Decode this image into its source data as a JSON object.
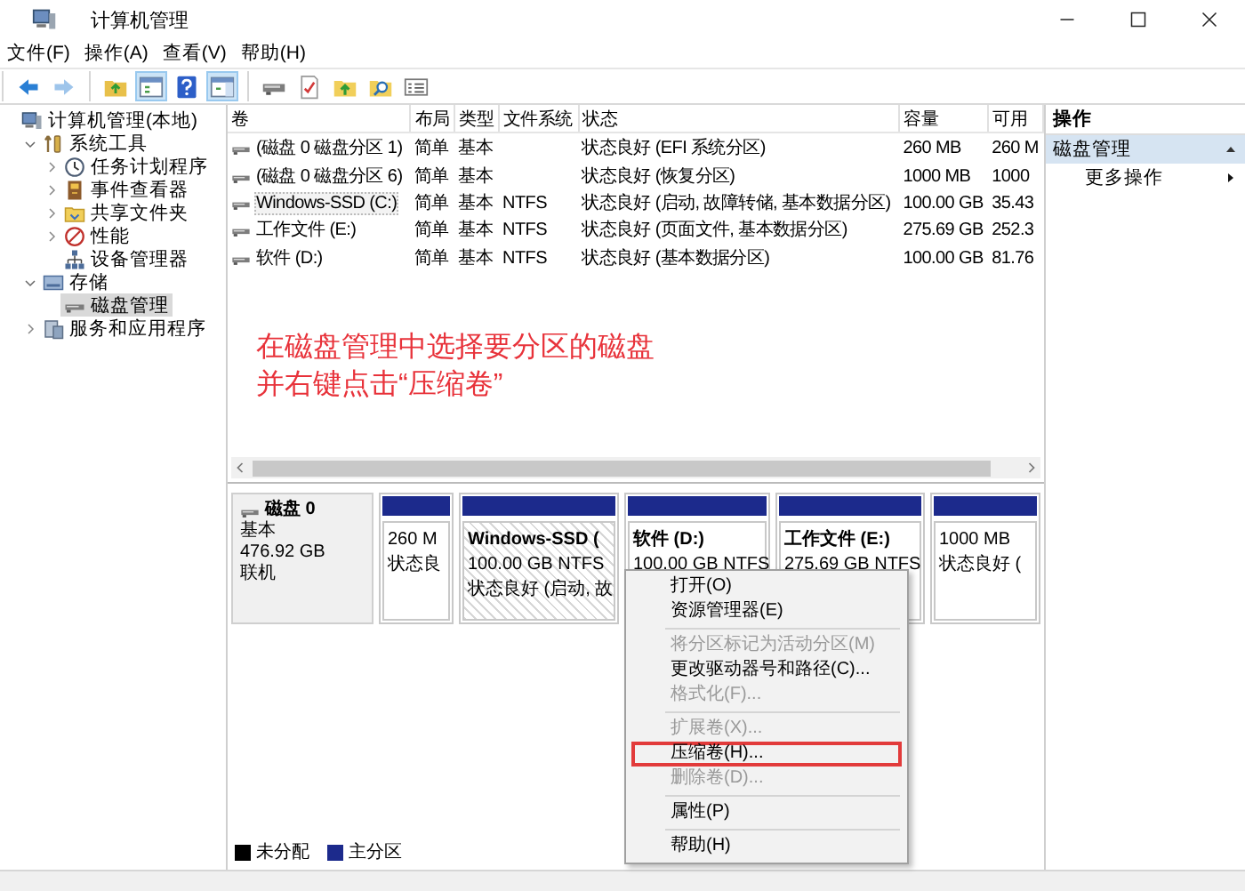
{
  "window": {
    "title": "计算机管理"
  },
  "menu": [
    "文件(F)",
    "操作(A)",
    "查看(V)",
    "帮助(H)"
  ],
  "toolbar": [
    [
      {
        "kind": "back",
        "pressed": false,
        "disabled": false
      },
      {
        "kind": "forward",
        "pressed": false,
        "disabled": true
      }
    ],
    [
      {
        "kind": "upfolder",
        "pressed": false,
        "disabled": false
      },
      {
        "kind": "tree",
        "pressed": true,
        "disabled": false
      },
      {
        "kind": "help",
        "pressed": false,
        "disabled": false
      },
      {
        "kind": "pane",
        "pressed": true,
        "disabled": false
      }
    ],
    [
      {
        "kind": "drive",
        "pressed": false,
        "disabled": false
      },
      {
        "kind": "check",
        "pressed": false,
        "disabled": false
      },
      {
        "kind": "folderarrow",
        "pressed": false,
        "disabled": false
      },
      {
        "kind": "foldersearch",
        "pressed": false,
        "disabled": false
      },
      {
        "kind": "list",
        "pressed": false,
        "disabled": false
      }
    ]
  ],
  "tree": [
    {
      "label": "计算机管理(本地)",
      "kind": "computer",
      "selected": false,
      "children": [
        {
          "label": "系统工具",
          "kind": "tools",
          "expanded": true,
          "selected": false,
          "children": [
            {
              "label": "任务计划程序",
              "kind": "clock",
              "expanded": false,
              "selected": false
            },
            {
              "label": "事件查看器",
              "kind": "log",
              "expanded": false,
              "selected": false
            },
            {
              "label": "共享文件夹",
              "kind": "share",
              "expanded": false,
              "selected": false
            },
            {
              "label": "性能",
              "kind": "perf",
              "expanded": false,
              "selected": false
            },
            {
              "label": "设备管理器",
              "kind": "device",
              "selected": false
            }
          ]
        },
        {
          "label": "存储",
          "kind": "storage",
          "expanded": true,
          "selected": false,
          "children": [
            {
              "label": "磁盘管理",
              "kind": "disk",
              "selected": true
            }
          ]
        },
        {
          "label": "服务和应用程序",
          "kind": "services",
          "expanded": false,
          "selected": false
        }
      ]
    }
  ],
  "table": {
    "columns": [
      "卷",
      "布局",
      "类型",
      "文件系统",
      "状态",
      "容量",
      "可用"
    ],
    "rows": [
      {
        "volume": "(磁盘 0 磁盘分区 1)",
        "layout": "简单",
        "type": "基本",
        "status": "状态良好 (EFI 系统分区)",
        "capacity": "260 MB",
        "free": "260 M",
        "selected": false
      },
      {
        "volume": "(磁盘 0 磁盘分区 6)",
        "layout": "简单",
        "type": "基本",
        "status": "状态良好 (恢复分区)",
        "capacity": "1000 MB",
        "free": "1000",
        "selected": false
      },
      {
        "volume": "Windows-SSD (C:)",
        "layout": "简单",
        "type": "基本",
        "filesystem": "NTFS",
        "status": "状态良好 (启动, 故障转储, 基本数据分区)",
        "capacity": "100.00 GB",
        "free": "35.43",
        "selected": true
      },
      {
        "volume": "工作文件 (E:)",
        "layout": "简单",
        "type": "基本",
        "filesystem": "NTFS",
        "status": "状态良好 (页面文件, 基本数据分区)",
        "capacity": "275.69 GB",
        "free": "252.3",
        "selected": false
      },
      {
        "volume": "软件 (D:)",
        "layout": "简单",
        "type": "基本",
        "filesystem": "NTFS",
        "status": "状态良好 (基本数据分区)",
        "capacity": "100.00 GB",
        "free": "81.76",
        "selected": false
      }
    ]
  },
  "annotation": [
    "在磁盘管理中选择要分区的磁盘",
    "并右键点击“压缩卷”"
  ],
  "disk": {
    "name": "磁盘 0",
    "type": "基本",
    "size": "476.92 GB",
    "status": "联机"
  },
  "partitions": [
    {
      "size": "260 M",
      "status": "状态良",
      "selected": false
    },
    {
      "name": "Windows-SSD (",
      "size": "100.00 GB NTFS",
      "status": "状态良好 (启动, 故",
      "selected": true
    },
    {
      "name": "软件 (D:)",
      "size": "100.00 GB NTFS",
      "selected": false
    },
    {
      "name": "工作文件 (E:)",
      "size": "275.69 GB NTFS",
      "selected": false
    },
    {
      "size": "1000 MB",
      "status": "状态良好 (",
      "selected": false
    }
  ],
  "legend": [
    {
      "label": "未分配",
      "color": "#000000"
    },
    {
      "label": "主分区",
      "color": "#1c2a8c"
    }
  ],
  "actions": {
    "title": "操作",
    "section": {
      "label": "磁盘管理",
      "expanded": true
    },
    "items": [
      "更多操作"
    ]
  },
  "context_menu": [
    [
      {
        "label": "打开(O)",
        "disabled": false,
        "annotated": false
      },
      {
        "label": "资源管理器(E)",
        "disabled": false,
        "annotated": false
      }
    ],
    [
      {
        "label": "将分区标记为活动分区(M)",
        "disabled": true,
        "annotated": false
      },
      {
        "label": "更改驱动器号和路径(C)...",
        "disabled": false,
        "annotated": false
      },
      {
        "label": "格式化(F)...",
        "disabled": true,
        "annotated": false
      }
    ],
    [
      {
        "label": "扩展卷(X)...",
        "disabled": true,
        "annotated": false
      },
      {
        "label": "压缩卷(H)...",
        "disabled": false,
        "annotated": true
      },
      {
        "label": "删除卷(D)...",
        "disabled": true,
        "annotated": false
      }
    ],
    [
      {
        "label": "属性(P)",
        "disabled": false,
        "annotated": false
      }
    ],
    [
      {
        "label": "帮助(H)",
        "disabled": false,
        "annotated": false
      }
    ]
  ]
}
